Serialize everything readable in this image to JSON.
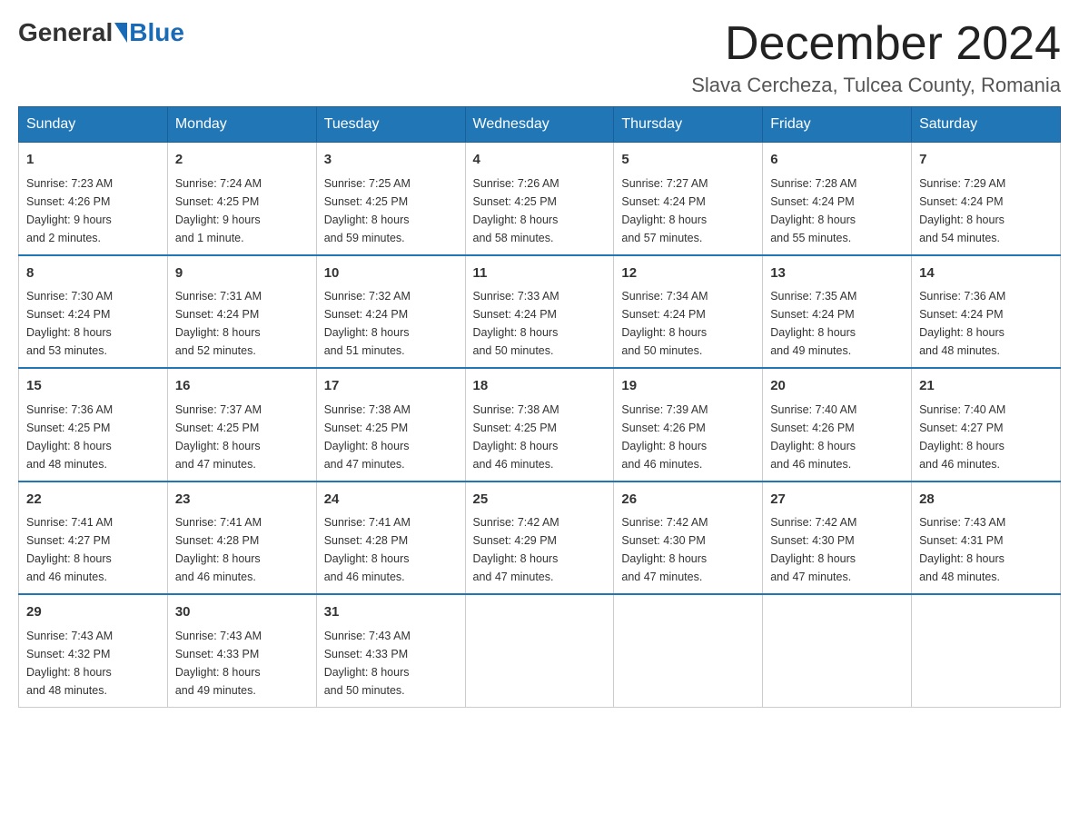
{
  "logo": {
    "text_before": "General",
    "text_after": "Blue"
  },
  "title": {
    "month_year": "December 2024",
    "location": "Slava Cercheza, Tulcea County, Romania"
  },
  "headers": [
    "Sunday",
    "Monday",
    "Tuesday",
    "Wednesday",
    "Thursday",
    "Friday",
    "Saturday"
  ],
  "weeks": [
    [
      {
        "day": "1",
        "sunrise": "7:23 AM",
        "sunset": "4:26 PM",
        "daylight": "9 hours and 2 minutes."
      },
      {
        "day": "2",
        "sunrise": "7:24 AM",
        "sunset": "4:25 PM",
        "daylight": "9 hours and 1 minute."
      },
      {
        "day": "3",
        "sunrise": "7:25 AM",
        "sunset": "4:25 PM",
        "daylight": "8 hours and 59 minutes."
      },
      {
        "day": "4",
        "sunrise": "7:26 AM",
        "sunset": "4:25 PM",
        "daylight": "8 hours and 58 minutes."
      },
      {
        "day": "5",
        "sunrise": "7:27 AM",
        "sunset": "4:24 PM",
        "daylight": "8 hours and 57 minutes."
      },
      {
        "day": "6",
        "sunrise": "7:28 AM",
        "sunset": "4:24 PM",
        "daylight": "8 hours and 55 minutes."
      },
      {
        "day": "7",
        "sunrise": "7:29 AM",
        "sunset": "4:24 PM",
        "daylight": "8 hours and 54 minutes."
      }
    ],
    [
      {
        "day": "8",
        "sunrise": "7:30 AM",
        "sunset": "4:24 PM",
        "daylight": "8 hours and 53 minutes."
      },
      {
        "day": "9",
        "sunrise": "7:31 AM",
        "sunset": "4:24 PM",
        "daylight": "8 hours and 52 minutes."
      },
      {
        "day": "10",
        "sunrise": "7:32 AM",
        "sunset": "4:24 PM",
        "daylight": "8 hours and 51 minutes."
      },
      {
        "day": "11",
        "sunrise": "7:33 AM",
        "sunset": "4:24 PM",
        "daylight": "8 hours and 50 minutes."
      },
      {
        "day": "12",
        "sunrise": "7:34 AM",
        "sunset": "4:24 PM",
        "daylight": "8 hours and 50 minutes."
      },
      {
        "day": "13",
        "sunrise": "7:35 AM",
        "sunset": "4:24 PM",
        "daylight": "8 hours and 49 minutes."
      },
      {
        "day": "14",
        "sunrise": "7:36 AM",
        "sunset": "4:24 PM",
        "daylight": "8 hours and 48 minutes."
      }
    ],
    [
      {
        "day": "15",
        "sunrise": "7:36 AM",
        "sunset": "4:25 PM",
        "daylight": "8 hours and 48 minutes."
      },
      {
        "day": "16",
        "sunrise": "7:37 AM",
        "sunset": "4:25 PM",
        "daylight": "8 hours and 47 minutes."
      },
      {
        "day": "17",
        "sunrise": "7:38 AM",
        "sunset": "4:25 PM",
        "daylight": "8 hours and 47 minutes."
      },
      {
        "day": "18",
        "sunrise": "7:38 AM",
        "sunset": "4:25 PM",
        "daylight": "8 hours and 46 minutes."
      },
      {
        "day": "19",
        "sunrise": "7:39 AM",
        "sunset": "4:26 PM",
        "daylight": "8 hours and 46 minutes."
      },
      {
        "day": "20",
        "sunrise": "7:40 AM",
        "sunset": "4:26 PM",
        "daylight": "8 hours and 46 minutes."
      },
      {
        "day": "21",
        "sunrise": "7:40 AM",
        "sunset": "4:27 PM",
        "daylight": "8 hours and 46 minutes."
      }
    ],
    [
      {
        "day": "22",
        "sunrise": "7:41 AM",
        "sunset": "4:27 PM",
        "daylight": "8 hours and 46 minutes."
      },
      {
        "day": "23",
        "sunrise": "7:41 AM",
        "sunset": "4:28 PM",
        "daylight": "8 hours and 46 minutes."
      },
      {
        "day": "24",
        "sunrise": "7:41 AM",
        "sunset": "4:28 PM",
        "daylight": "8 hours and 46 minutes."
      },
      {
        "day": "25",
        "sunrise": "7:42 AM",
        "sunset": "4:29 PM",
        "daylight": "8 hours and 47 minutes."
      },
      {
        "day": "26",
        "sunrise": "7:42 AM",
        "sunset": "4:30 PM",
        "daylight": "8 hours and 47 minutes."
      },
      {
        "day": "27",
        "sunrise": "7:42 AM",
        "sunset": "4:30 PM",
        "daylight": "8 hours and 47 minutes."
      },
      {
        "day": "28",
        "sunrise": "7:43 AM",
        "sunset": "4:31 PM",
        "daylight": "8 hours and 48 minutes."
      }
    ],
    [
      {
        "day": "29",
        "sunrise": "7:43 AM",
        "sunset": "4:32 PM",
        "daylight": "8 hours and 48 minutes."
      },
      {
        "day": "30",
        "sunrise": "7:43 AM",
        "sunset": "4:33 PM",
        "daylight": "8 hours and 49 minutes."
      },
      {
        "day": "31",
        "sunrise": "7:43 AM",
        "sunset": "4:33 PM",
        "daylight": "8 hours and 50 minutes."
      },
      null,
      null,
      null,
      null
    ]
  ],
  "labels": {
    "sunrise": "Sunrise:",
    "sunset": "Sunset:",
    "daylight": "Daylight:"
  }
}
